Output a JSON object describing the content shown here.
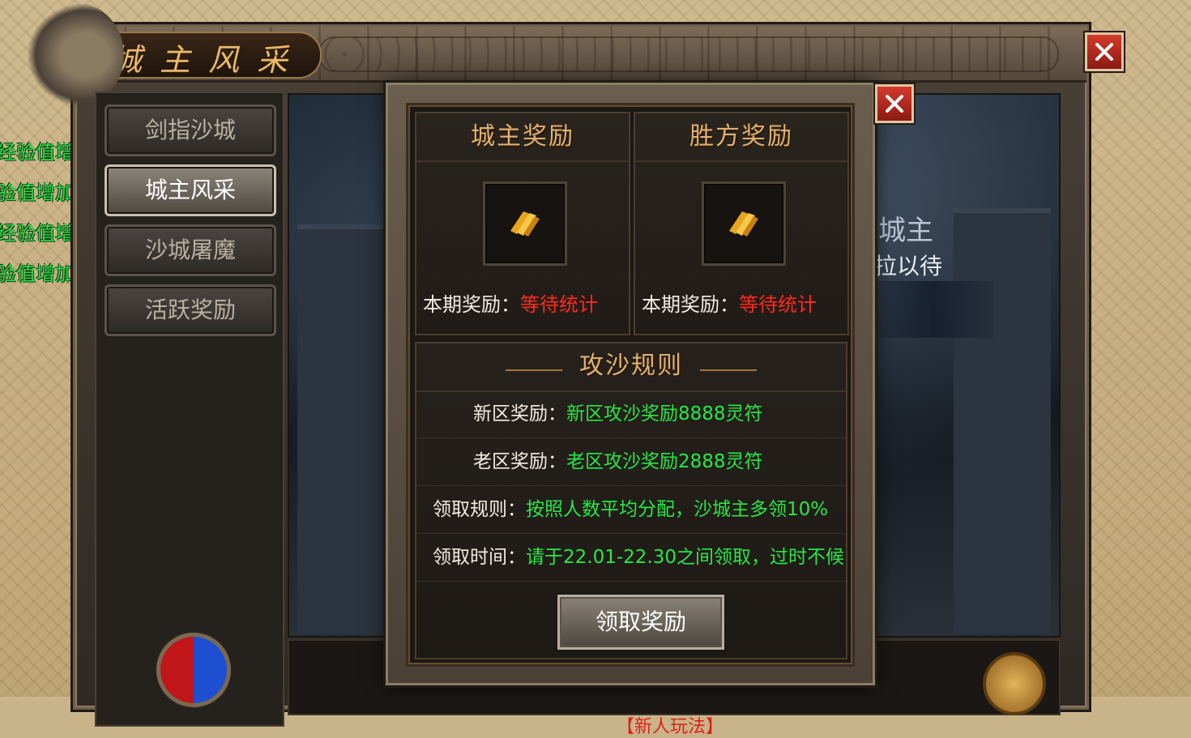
{
  "chat": [
    "经验值增加.",
    "验值增加.",
    "经验值增加.",
    "验值增加."
  ],
  "window": {
    "title": "城主风采"
  },
  "sidebar": {
    "items": [
      {
        "label": "剑指沙城",
        "active": false
      },
      {
        "label": "城主风采",
        "active": true
      },
      {
        "label": "沙城屠魔",
        "active": false
      },
      {
        "label": "活跃奖励",
        "active": false
      }
    ]
  },
  "art": {
    "banner_title": "城主",
    "banner_sub": "拉以待"
  },
  "bottom_text": "【新人玩法】",
  "popup": {
    "rewards": [
      {
        "header": "城主奖励",
        "label": "本期奖励：",
        "value": "等待统计",
        "item_icon": "gold-tally-icon"
      },
      {
        "header": "胜方奖励",
        "label": "本期奖励：",
        "value": "等待统计",
        "item_icon": "gold-tally-icon"
      }
    ],
    "rules": {
      "title": "攻沙规则",
      "rows": [
        {
          "label": "新区奖励：",
          "value": "新区攻沙奖励8888灵符"
        },
        {
          "label": "老区奖励：",
          "value": "老区攻沙奖励2888灵符"
        },
        {
          "label": "领取规则：",
          "value": "按照人数平均分配，沙城主多领10%"
        },
        {
          "label": "领取时间：",
          "value": "请于22.01-22.30之间领取，过时不候"
        }
      ]
    },
    "claim_button": "领取奖励"
  },
  "colors": {
    "value_red": "#ff2a1a",
    "value_green": "#27e845",
    "header_gold": "#e0b070"
  }
}
